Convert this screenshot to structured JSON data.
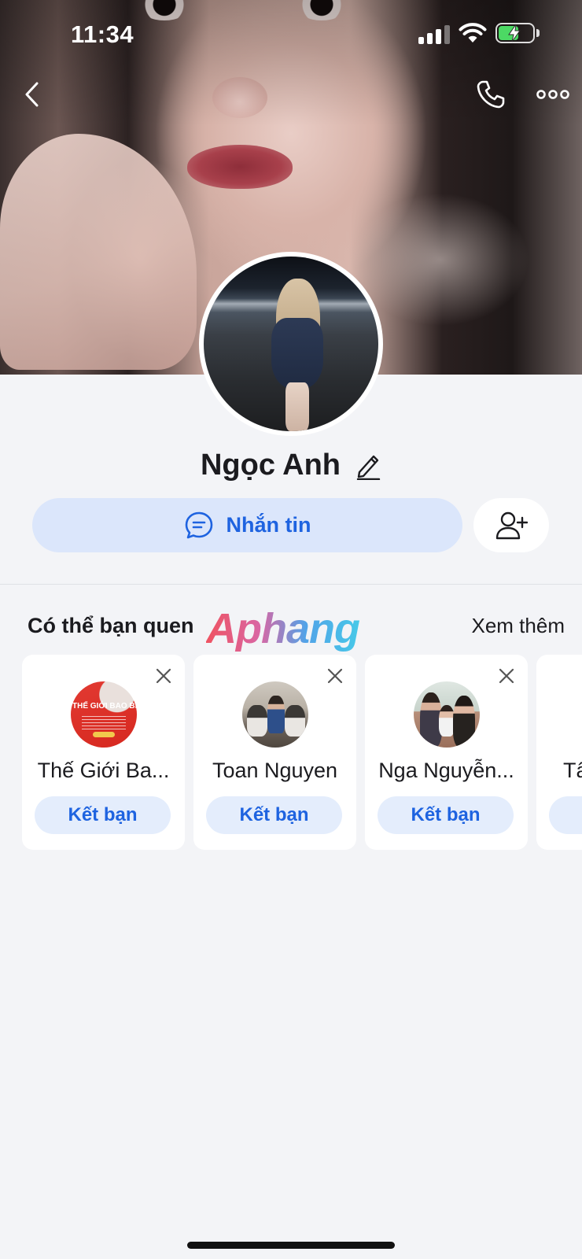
{
  "status_bar": {
    "time": "11:34",
    "battery_level": 0.55,
    "signal_bars": 3,
    "signal_bars_total": 4
  },
  "icons": {
    "back": "chevron-left-icon",
    "call": "phone-icon",
    "more": "more-horizontal-icon",
    "edit": "pencil-icon",
    "message": "chat-bubble-icon",
    "add_friend": "add-user-icon",
    "close": "close-icon"
  },
  "profile": {
    "name": "Ngọc Anh"
  },
  "actions": {
    "message_label": "Nhắn tin"
  },
  "suggestions": {
    "title": "Có thể bạn quen",
    "see_more": "Xem thêm",
    "cards": [
      {
        "name": "Thế Giới Ba...",
        "button": "Kết bạn",
        "avatar_text": "THẾ GIỚI BAO BÌ"
      },
      {
        "name": "Toan Nguyen",
        "button": "Kết bạn"
      },
      {
        "name": "Nga Nguyễn...",
        "button": "Kết bạn"
      },
      {
        "name": "Tâ",
        "button": ""
      }
    ]
  },
  "watermark": "Aphang",
  "colors": {
    "accent": "#1e63e0",
    "message_button_bg": "#dbe6fb",
    "card_button_bg": "#e4edfc",
    "page_bg": "#f3f4f7",
    "battery_fill": "#4cd964"
  }
}
